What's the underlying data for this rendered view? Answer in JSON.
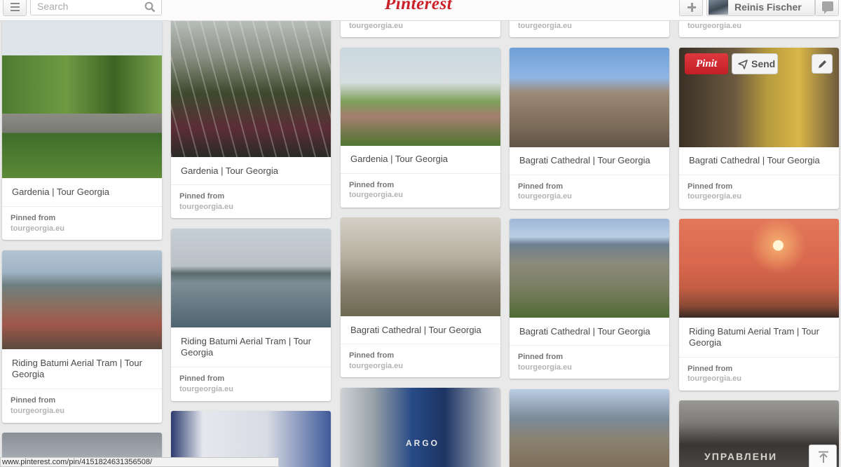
{
  "header": {
    "search_placeholder": "Search",
    "logo": "Pinterest",
    "user_name": "Reinis Fischer",
    "logo_color": "#cb2027"
  },
  "hover_actions": {
    "pinit_label": "Pinit",
    "send_label": "Send"
  },
  "columns": [
    {
      "top_domain": null,
      "pins": [
        {
          "image": "greenhouse",
          "description": "Gardenia | Tour Georgia",
          "pinned_label": "Pinned from",
          "domain": "tourgeorgia.eu"
        },
        {
          "image": "batumi",
          "description": "Riding Batumi Aerial Tram | Tour Georgia",
          "pinned_label": "Pinned from",
          "domain": "tourgeorgia.eu"
        },
        {
          "image": "clouds"
        }
      ]
    },
    {
      "top_domain": null,
      "pins": [
        {
          "image": "greenhouse-interior",
          "description": "Gardenia | Tour Georgia",
          "pinned_label": "Pinned from",
          "domain": "tourgeorgia.eu"
        },
        {
          "image": "sea",
          "description": "Riding Batumi Aerial Tram | Tour Georgia",
          "pinned_label": "Pinned from",
          "domain": "tourgeorgia.eu"
        },
        {
          "image": "metro"
        }
      ]
    },
    {
      "top_domain": "tourgeorgia.eu",
      "pins": [
        {
          "image": "garden",
          "description": "Gardenia | Tour Georgia",
          "pinned_label": "Pinned from",
          "domain": "tourgeorgia.eu"
        },
        {
          "image": "ruins",
          "description": "Bagrati Cathedral | Tour Georgia",
          "pinned_label": "Pinned from",
          "domain": "tourgeorgia.eu"
        },
        {
          "image": "cable-car",
          "caption": "ARGO"
        }
      ]
    },
    {
      "top_domain": "tourgeorgia.eu",
      "pins": [
        {
          "image": "cathedral",
          "description": "Bagrati Cathedral | Tour Georgia",
          "pinned_label": "Pinned from",
          "domain": "tourgeorgia.eu"
        },
        {
          "image": "city",
          "description": "Bagrati Cathedral | Tour Georgia",
          "pinned_label": "Pinned from",
          "domain": "tourgeorgia.eu"
        },
        {
          "image": "city-mountains"
        }
      ]
    },
    {
      "top_domain": "tourgeorgia.eu",
      "pins": [
        {
          "image": "church-interior",
          "description": "Bagrati Cathedral | Tour Georgia",
          "pinned_label": "Pinned from",
          "domain": "tourgeorgia.eu"
        },
        {
          "image": "sunset",
          "description": "Riding Batumi Aerial Tram | Tour Georgia",
          "pinned_label": "Pinned from",
          "domain": "tourgeorgia.eu"
        },
        {
          "image": "plaque",
          "caption": "УПРАВЛЕНИ"
        }
      ]
    }
  ],
  "status_url": "www.pinterest.com/pin/415182463135650​8/"
}
